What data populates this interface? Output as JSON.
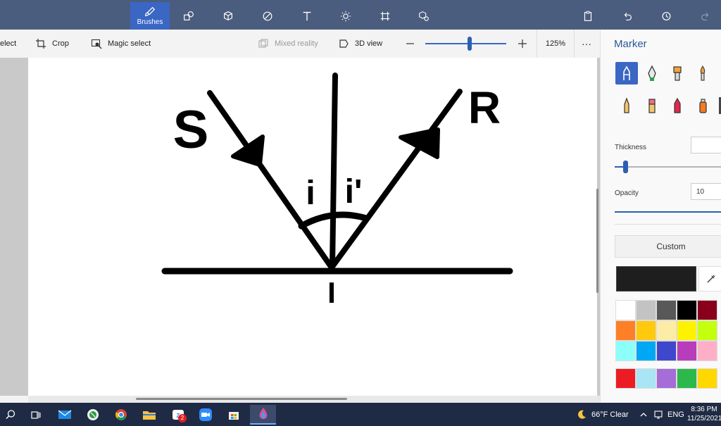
{
  "toolbar": {
    "brushes_label": "Brushes",
    "colors": {
      "topbar": "#4a5d7e",
      "active": "#3a66c4"
    }
  },
  "subbar": {
    "select_label": "elect",
    "crop_label": "Crop",
    "magic_select_label": "Magic select",
    "mixed_reality_label": "Mixed reality",
    "view_3d_label": "3D view",
    "zoom_value": "125%",
    "zoom_level": 0.55,
    "more_label": "···"
  },
  "drawing": {
    "label_s": "S",
    "label_r": "R",
    "label_i_incident": "i",
    "label_i_reflected": "i'",
    "label_point": "I"
  },
  "panel": {
    "title": "Marker",
    "thickness_label": "Thickness",
    "thickness_value": "",
    "thickness_level": 0.1,
    "opacity_label": "Opacity",
    "opacity_value": "10",
    "opacity_level": 1.0,
    "custom_label": "Custom",
    "current_color": "#1e1e1e",
    "brushes": [
      "marker-icon",
      "calligraphy-pen-icon",
      "oil-brush-icon",
      "watercolor-icon",
      "pencil-icon",
      "eraser-icon",
      "crayon-icon",
      "spray-can-icon"
    ],
    "palette_rows": [
      [
        "#ffffff",
        "#c3c3c3",
        "#585858",
        "#000000",
        "#88001b"
      ],
      [
        "#ff7f27",
        "#ffc90e",
        "#fdeca6",
        "#fff200",
        "#c4ff0e"
      ],
      [
        "#8cfffb",
        "#00a8f3",
        "#3f48cc",
        "#b83dba",
        "#ffaec8"
      ],
      [
        "#ec1c24",
        "#a8e6f5",
        "#a66cd8",
        "#2db84c",
        "#ffd800"
      ]
    ]
  },
  "taskbar": {
    "weather": "66°F  Clear",
    "language": "ENG",
    "time": "8:36 PM",
    "date": "11/25/2021",
    "zoom_badge": "2",
    "icons": [
      "search-icon",
      "task-view-icon",
      "mail-icon",
      "app-icon",
      "chrome-icon",
      "file-explorer-icon",
      "zoom-chat-icon",
      "zoom-icon",
      "store-icon",
      "paint3d-icon"
    ]
  }
}
